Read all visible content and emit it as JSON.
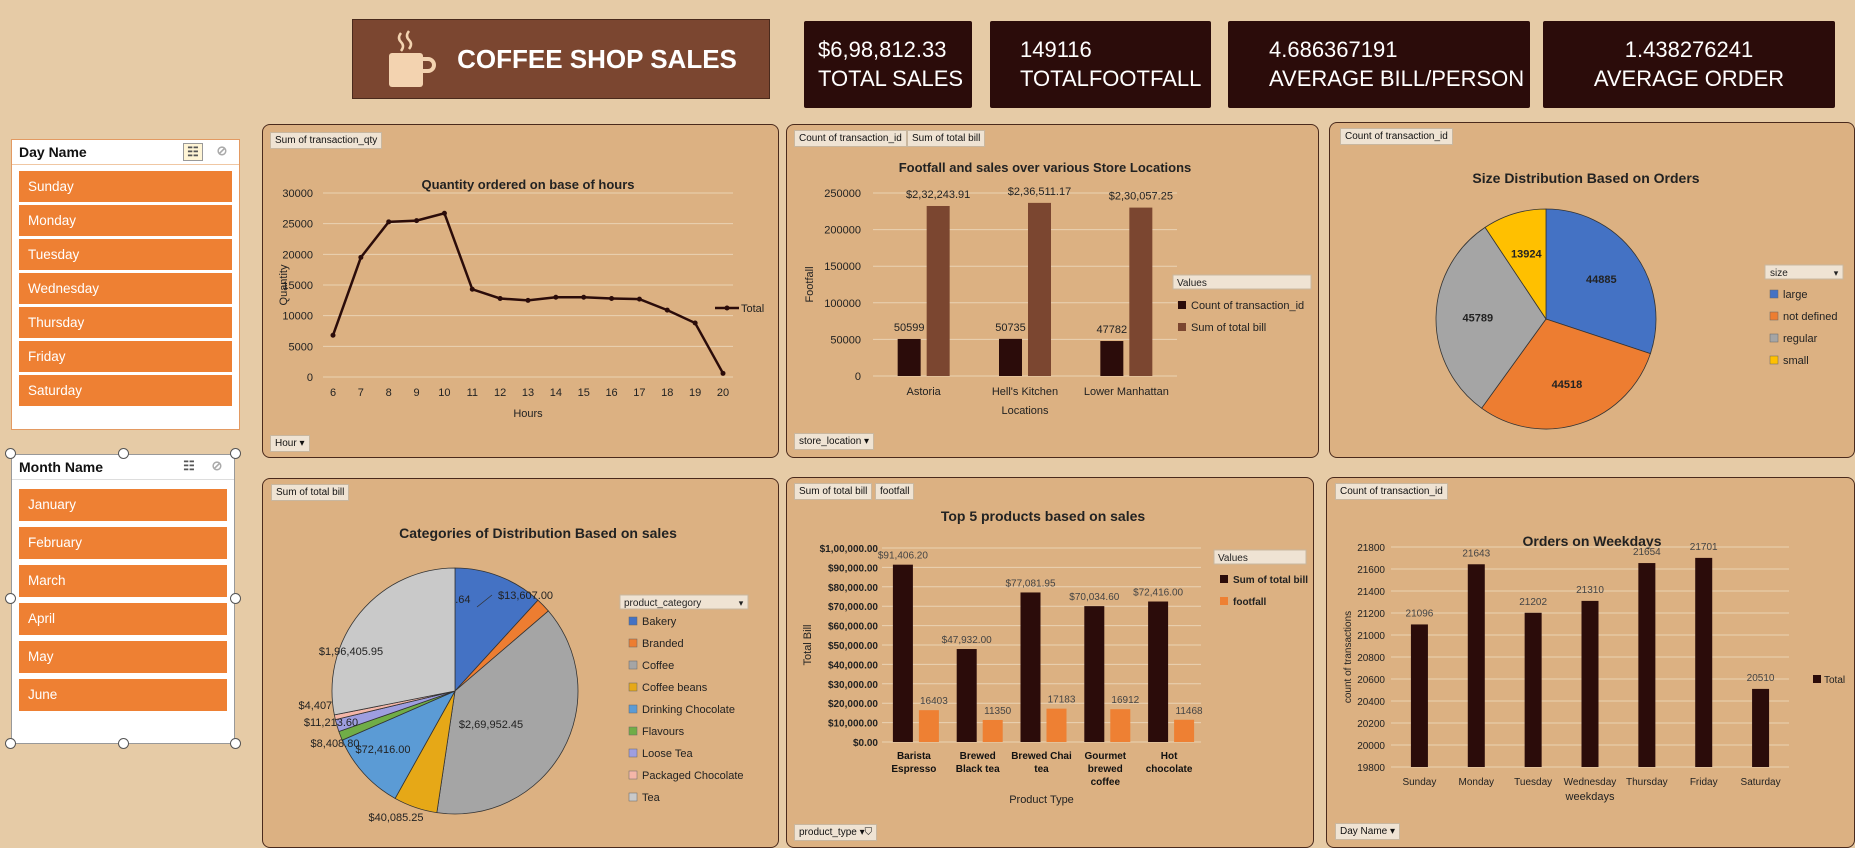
{
  "header": {
    "title": "COFFEE SHOP SALES",
    "logo_icon": "coffee-cup-icon"
  },
  "kpis": [
    {
      "value": "$6,98,812.33",
      "label": "TOTAL SALES"
    },
    {
      "value": "149116",
      "label": "TOTALFOOTFALL"
    },
    {
      "value": "4.686367191",
      "label": "AVERAGE BILL/PERSON"
    },
    {
      "value": "1.438276241",
      "label": "AVERAGE ORDER"
    }
  ],
  "day_slicer": {
    "title": "Day Name",
    "items": [
      "Sunday",
      "Monday",
      "Tuesday",
      "Wednesday",
      "Thursday",
      "Friday",
      "Saturday"
    ]
  },
  "month_slicer": {
    "title": "Month Name",
    "items": [
      "January",
      "February",
      "March",
      "April",
      "May",
      "June"
    ]
  },
  "colors": {
    "dark": "#2b0c0a",
    "brown": "#7b4630",
    "orange": "#ee8033",
    "panel": "#dcb182"
  },
  "chart_data": [
    {
      "type": "line",
      "field_tag": "Sum of transaction_qty",
      "filter_tag": "Hour",
      "title": "Quantity ordered on base of hours",
      "xlabel": "Hours",
      "ylabel": "Quantity",
      "x": [
        6,
        7,
        8,
        9,
        10,
        11,
        12,
        13,
        14,
        15,
        16,
        17,
        18,
        19,
        20
      ],
      "series": [
        {
          "name": "Total",
          "values": [
            6800,
            19500,
            25300,
            25500,
            26700,
            14300,
            12800,
            12500,
            13000,
            13000,
            12800,
            12700,
            10900,
            8800,
            600
          ]
        }
      ],
      "ylim": [
        0,
        30000
      ],
      "yticks": [
        0,
        5000,
        10000,
        15000,
        20000,
        25000,
        30000
      ],
      "legend": "right",
      "grid": true
    },
    {
      "type": "bar",
      "field_tags": [
        "Count of transaction_id",
        "Sum of total bill"
      ],
      "filter_tag": "store_location",
      "title": "Footfall and sales over various Store Locations",
      "xlabel": "Locations",
      "ylabel": "Footfall",
      "categories": [
        "Astoria",
        "Hell's Kitchen",
        "Lower Manhattan"
      ],
      "series": [
        {
          "name": "Count of transaction_id",
          "values": [
            50599,
            50735,
            47782
          ],
          "labels": [
            "50599",
            "50735",
            "47782"
          ]
        },
        {
          "name": "Sum of total bill",
          "values": [
            232243.91,
            236511.17,
            230057.25
          ],
          "labels": [
            "$2,32,243.91",
            "$2,36,511.17",
            "$2,30,057.25"
          ]
        }
      ],
      "ylim": [
        0,
        250000
      ],
      "yticks": [
        0,
        50000,
        100000,
        150000,
        200000,
        250000
      ],
      "legend_title": "Values",
      "legend": "right",
      "grid": true
    },
    {
      "type": "pie",
      "field_tag": "Count of transaction_id",
      "title": "Size Distribution Based on Orders",
      "legend_title": "size",
      "slices": [
        {
          "name": "large",
          "value": 44885
        },
        {
          "name": "not defined",
          "value": 44518
        },
        {
          "name": "regular",
          "value": 45789
        },
        {
          "name": "small",
          "value": 13924
        }
      ],
      "colors": [
        "#4472c4",
        "#ed7d31",
        "#a5a5a5",
        "#ffc000"
      ],
      "legend": "right"
    },
    {
      "type": "pie",
      "field_tag": "Sum of total bill",
      "title": "Categories of  Distribution Based on sales",
      "legend_title": "product_category",
      "slices": [
        {
          "name": "Bakery",
          "value": 82315.64,
          "label": "$82,315.64"
        },
        {
          "name": "Branded",
          "value": 13607.0,
          "label": "$13,607.00"
        },
        {
          "name": "Coffee",
          "value": 269952.45,
          "label": "$2,69,952.45"
        },
        {
          "name": "Coffee beans",
          "value": 40085.25,
          "label": "$40,085.25"
        },
        {
          "name": "Drinking Chocolate",
          "value": 72416.0,
          "label": "$72,416.00"
        },
        {
          "name": "Flavours",
          "value": 8408.8,
          "label": "$8,408.80"
        },
        {
          "name": "Loose Tea",
          "value": 11213.6,
          "label": "$11,213.60"
        },
        {
          "name": "Packaged Chocolate",
          "value": 4407.64,
          "label": "$4,407.64"
        },
        {
          "name": "Tea",
          "value": 196405.95,
          "label": "$1,96,405.95"
        }
      ],
      "colors": [
        "#4472c4",
        "#ed7d31",
        "#a5a5a5",
        "#e6a817",
        "#5b9bd5",
        "#70ad47",
        "#9e9ee0",
        "#f4b6a8",
        "#c9c9c9"
      ],
      "legend": "right"
    },
    {
      "type": "bar",
      "field_tags": [
        "Sum of total bill",
        "footfall"
      ],
      "filter_tag": "product_type",
      "title": "Top 5 products based on sales",
      "xlabel": "Product Type",
      "ylabel": "Total Bill",
      "categories": [
        "Barista Espresso",
        "Brewed Black tea",
        "Brewed Chai tea",
        "Gourmet brewed coffee",
        "Hot chocolate"
      ],
      "series": [
        {
          "name": "Sum of total bill",
          "values": [
            91406.2,
            47932.0,
            77081.95,
            70034.6,
            72416.0
          ],
          "labels": [
            "$91,406.20",
            "$47,932.00",
            "$77,081.95",
            "$70,034.60",
            "$72,416.00"
          ]
        },
        {
          "name": "footfall",
          "values": [
            16403,
            11350,
            17183,
            16912,
            11468
          ],
          "labels": [
            "16403",
            "11350",
            "17183",
            "16912",
            "11468"
          ]
        }
      ],
      "ylim": [
        0,
        100000
      ],
      "ytick_labels": [
        "$0.00",
        "$10,000.00",
        "$20,000.00",
        "$30,000.00",
        "$40,000.00",
        "$50,000.00",
        "$60,000.00",
        "$70,000.00",
        "$80,000.00",
        "$90,000.00",
        "$1,00,000.00"
      ],
      "legend_title": "Values",
      "legend": "right",
      "grid": true
    },
    {
      "type": "bar",
      "field_tag": "Count of transaction_id",
      "filter_tag": "Day Name",
      "title": "Orders on Weekdays",
      "xlabel": "weekdays",
      "ylabel": "count of transactions",
      "categories": [
        "Sunday",
        "Monday",
        "Tuesday",
        "Wednesday",
        "Thursday",
        "Friday",
        "Saturday"
      ],
      "series": [
        {
          "name": "Total",
          "values": [
            21096,
            21643,
            21202,
            21310,
            21654,
            21701,
            20510
          ]
        }
      ],
      "ylim": [
        19800,
        21800
      ],
      "yticks": [
        19800,
        20000,
        20200,
        20400,
        20600,
        20800,
        21000,
        21200,
        21400,
        21600,
        21800
      ],
      "legend": "right",
      "grid": true
    }
  ]
}
